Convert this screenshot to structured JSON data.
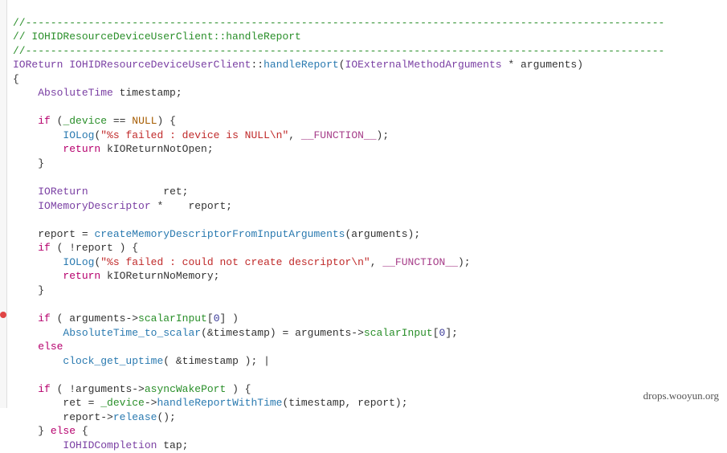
{
  "code": {
    "line1": "//------------------------------------------------------------------------------------------------------",
    "line2_a": "// ",
    "line2_b": "IOHIDResourceDeviceUserClient::handleReport",
    "line3": "//------------------------------------------------------------------------------------------------------",
    "l4_ret": "IOReturn",
    "l4_cls": "IOHIDResourceDeviceUserClient",
    "l4_sep": "::",
    "l4_fn": "handleReport",
    "l4_open": "(",
    "l4_argt": "IOExternalMethodArguments",
    "l4_star": " * ",
    "l4_argn": "arguments",
    "l4_close": ")",
    "l5": "{",
    "l6_type": "AbsoluteTime",
    "l6_var": " timestamp;",
    "l8_if": "if",
    "l8_open": " (",
    "l8_dev": "_device",
    "l8_eq": " == ",
    "l8_null": "NULL",
    "l8_close": ") {",
    "l9_fn": "IOLog",
    "l9_open": "(",
    "l9_str": "\"%s failed : device is NULL\\n\"",
    "l9_comma": ", ",
    "l9_macro": "__FUNCTION__",
    "l9_close": ");",
    "l10_ret": "return",
    "l10_v": " kIOReturnNotOpen;",
    "l11": "}",
    "l13_t": "IOReturn",
    "l13_sp": "            ",
    "l13_v": "ret;",
    "l14_t": "IOMemoryDescriptor",
    "l14_sp": " *    ",
    "l14_v": "report;",
    "l16_a": "report = ",
    "l16_fn": "createMemoryDescriptorFromInputArguments",
    "l16_b": "(arguments);",
    "l17_if": "if",
    "l17_r": " ( !report ) {",
    "l18_fn": "IOLog",
    "l18_open": "(",
    "l18_str": "\"%s failed : could not create descriptor\\n\"",
    "l18_comma": ", ",
    "l18_macro": "__FUNCTION__",
    "l18_close": ");",
    "l19_ret": "return",
    "l19_v": " kIOReturnNoMemory;",
    "l20": "}",
    "l22_if": "if",
    "l22_a": " ( arguments->",
    "l22_m": "scalarInput",
    "l22_b": "[",
    "l22_n": "0",
    "l22_c": "] )",
    "l23_fn": "AbsoluteTime_to_scalar",
    "l23_a": "(&timestamp) = arguments->",
    "l23_m": "scalarInput",
    "l23_b": "[",
    "l23_n": "0",
    "l23_c": "];",
    "l24": "else",
    "l25_fn": "clock_get_uptime",
    "l25_r": "( &timestamp ); |",
    "l27_if": "if",
    "l27_a": " ( !arguments->",
    "l27_m": "asyncWakePort",
    "l27_b": " ) {",
    "l28_a": "ret = ",
    "l28_dev": "_device",
    "l28_ar": "->",
    "l28_fn": "handleReportWithTime",
    "l28_b": "(timestamp, report);",
    "l29_a": "report->",
    "l29_fn": "release",
    "l29_b": "();",
    "l30_a": "} ",
    "l30_else": "else",
    "l30_b": " {",
    "l31_t": "IOHIDCompletion",
    "l31_v": " tap;"
  },
  "watermark": "drops.wooyun.org"
}
